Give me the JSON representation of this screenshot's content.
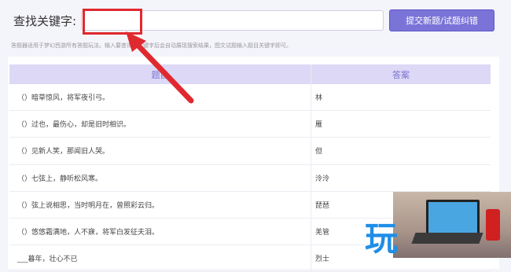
{
  "search": {
    "label": "查找关键字:",
    "value": "",
    "placeholder": ""
  },
  "submit_label": "提交新题/试题纠错",
  "hint": "答题器适用于梦幻西游所有答题玩法。输入要查询的关键字后会自动展现搜索结果，图文试题输入题目关键字即可。",
  "table": {
    "headers": [
      "题目",
      "答案"
    ],
    "rows": [
      {
        "q": "（）暗草惊风，将军夜引弓。",
        "a": "林"
      },
      {
        "q": "（）过也，最伤心，却是旧时相识。",
        "a": "雁"
      },
      {
        "q": "（）见新人笑，那闻旧人哭。",
        "a": "但"
      },
      {
        "q": "（）七弦上，静听松风寒。",
        "a": "泠泠"
      },
      {
        "q": "（）弦上说相思，当时明月在，曾照彩云归。",
        "a": "琵琶"
      },
      {
        "q": "（）悠悠霜满地，人不寐，将军白发征夫泪。",
        "a": "羌管"
      },
      {
        "q": "___暮年，壮心不已",
        "a": "烈士"
      }
    ]
  },
  "logo_char": "玩",
  "colors": {
    "accent": "#7a74d8",
    "header_bg": "#dcd8f6",
    "annotation": "#e0292f"
  }
}
